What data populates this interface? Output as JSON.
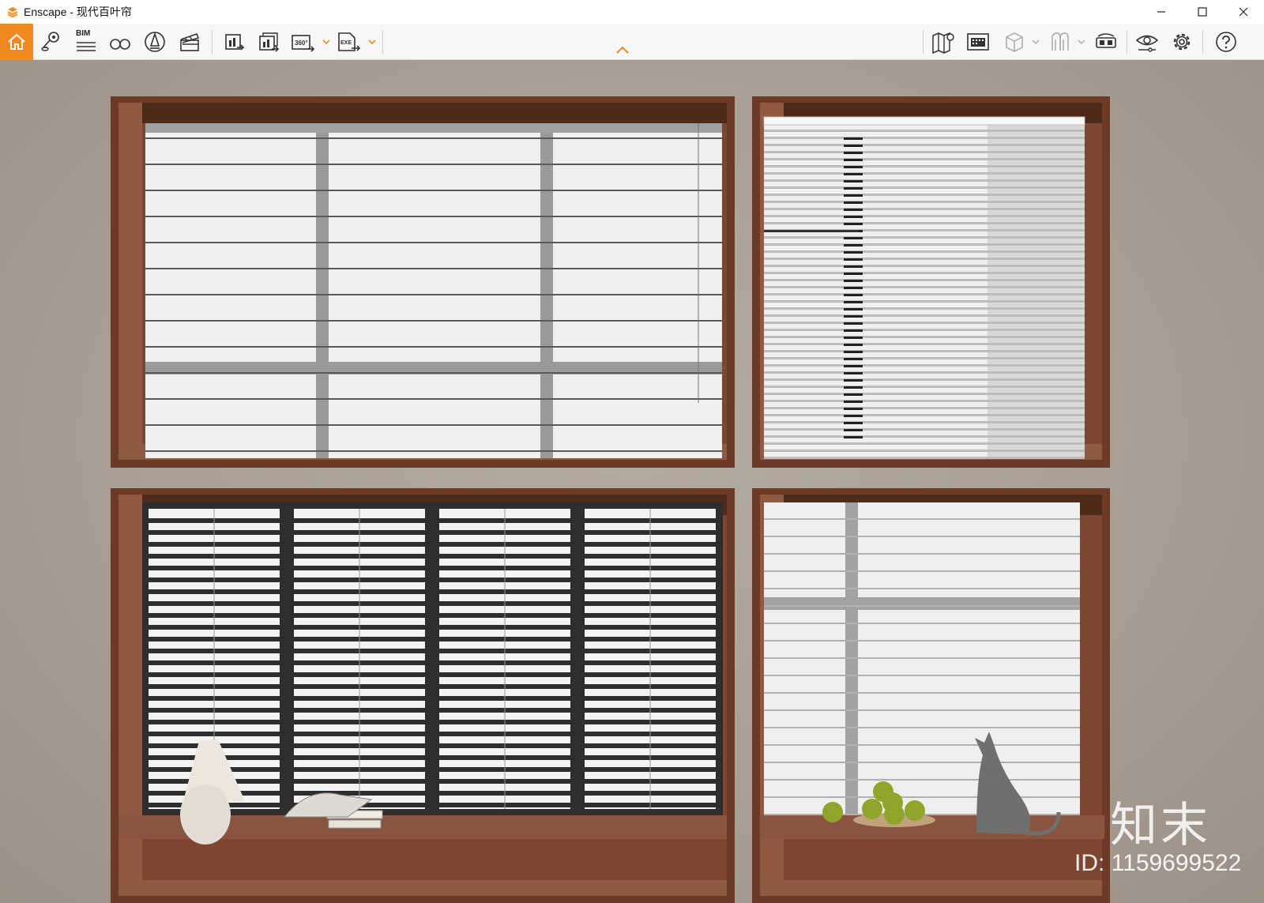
{
  "window": {
    "app_name": "Enscape",
    "title": "Enscape - 现代百叶帘",
    "brand_color": "#f08a1e"
  },
  "window_controls": [
    "minimize-icon",
    "maximize-icon",
    "close-icon"
  ],
  "toolbar": {
    "left_buttons": [
      {
        "name": "home",
        "icon": "home-icon",
        "active": true
      },
      {
        "name": "views",
        "icon": "location-pin-icon"
      },
      {
        "name": "bim",
        "icon": "bim-icon",
        "label": "BIM"
      },
      {
        "name": "look-around",
        "icon": "binoculars-icon"
      },
      {
        "name": "asset-library",
        "icon": "asset-library-icon"
      },
      {
        "name": "video-editor",
        "icon": "clapperboard-icon"
      },
      {
        "name": "screenshot",
        "icon": "screenshot-export-icon"
      },
      {
        "name": "batch-render",
        "icon": "batch-render-icon"
      },
      {
        "name": "panorama",
        "icon": "panorama-360-icon",
        "label": "360°",
        "dropdown": true
      },
      {
        "name": "exe-export",
        "icon": "exe-export-icon",
        "label": "EXE",
        "dropdown": true
      }
    ],
    "right_buttons": [
      {
        "name": "map",
        "icon": "map-pin-icon"
      },
      {
        "name": "project-manager",
        "icon": "building-icon"
      },
      {
        "name": "view-cube",
        "icon": "cube-icon",
        "dropdown": true,
        "disabled": true
      },
      {
        "name": "upload",
        "icon": "people-icon",
        "dropdown": true,
        "disabled": true
      },
      {
        "name": "vr-headset",
        "icon": "vr-headset-icon"
      },
      {
        "name": "visual-settings",
        "icon": "eye-icon"
      },
      {
        "name": "general-settings",
        "icon": "gear-icon"
      },
      {
        "name": "help",
        "icon": "help-icon"
      }
    ],
    "collapse": "chevron-up-icon"
  },
  "viewport": {
    "watermark": "知末",
    "watermark_id": "ID: 1159699522",
    "scene": "Four window blinds rendered in brown wooden frames on a beige wall"
  }
}
